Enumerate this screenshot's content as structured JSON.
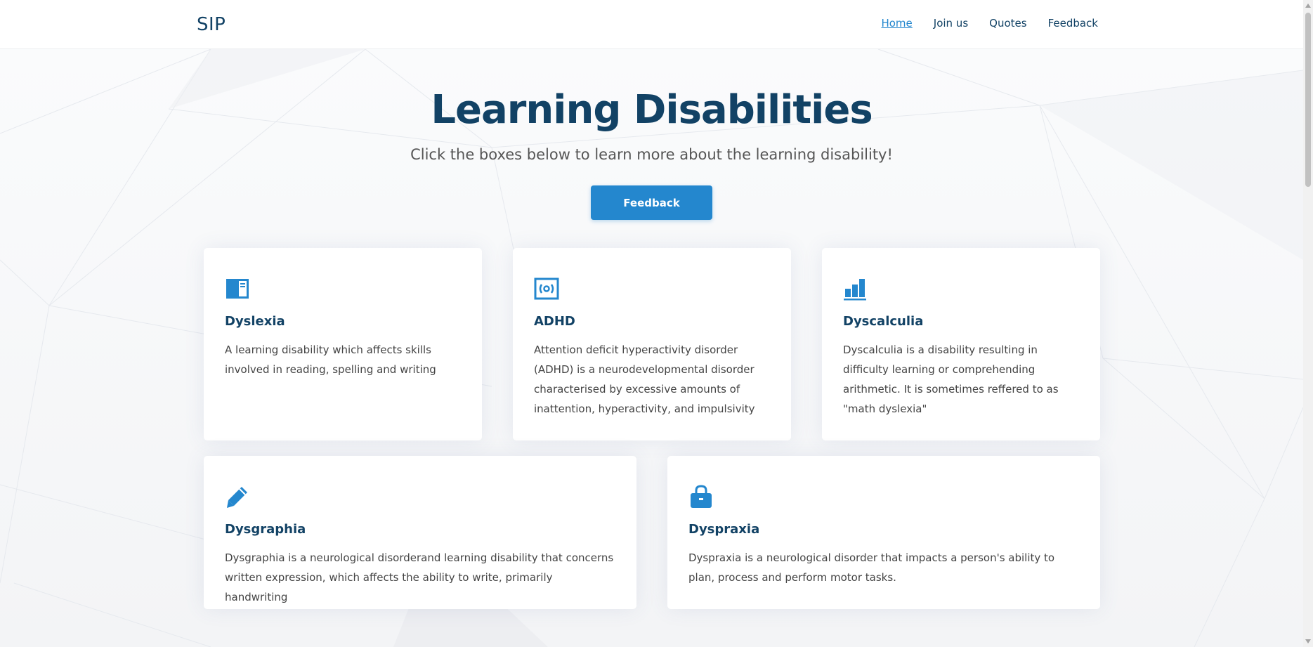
{
  "header": {
    "logo": "SIP",
    "nav": [
      {
        "label": "Home",
        "active": true
      },
      {
        "label": "Join us",
        "active": false
      },
      {
        "label": "Quotes",
        "active": false
      },
      {
        "label": "Feedback",
        "active": false
      }
    ]
  },
  "hero": {
    "title": "Learning Disabilities",
    "subtitle": "Click the boxes below to learn more about the learning disability!",
    "button_label": "Feedback"
  },
  "cards": [
    {
      "icon": "book-icon",
      "title": "Dyslexia",
      "text": "A learning disability which affects skills involved in reading, spelling and writing"
    },
    {
      "icon": "broadcast-icon",
      "title": "ADHD",
      "text": "Attention deficit hyperactivity disorder (ADHD) is a neurodevelopmental disorder characterised by excessive amounts of inattention, hyperactivity, and impulsivity"
    },
    {
      "icon": "bar-chart-icon",
      "title": "Dyscalculia",
      "text": "Dyscalculia is a disability resulting in difficulty learning or comprehending arithmetic. It is sometimes reffered to as \"math dyslexia\""
    },
    {
      "icon": "pencil-icon",
      "title": "Dysgraphia",
      "text": "Dysgraphia is a neurological disorderand learning disability that concerns written expression, which affects the ability to write, primarily handwriting"
    },
    {
      "icon": "bag-icon",
      "title": "Dyspraxia",
      "text": "Dyspraxia is a neurological disorder that impacts a person's ability to plan, process and perform motor tasks."
    }
  ],
  "colors": {
    "accent": "#2487ce",
    "heading": "#124265",
    "text": "#444444"
  }
}
